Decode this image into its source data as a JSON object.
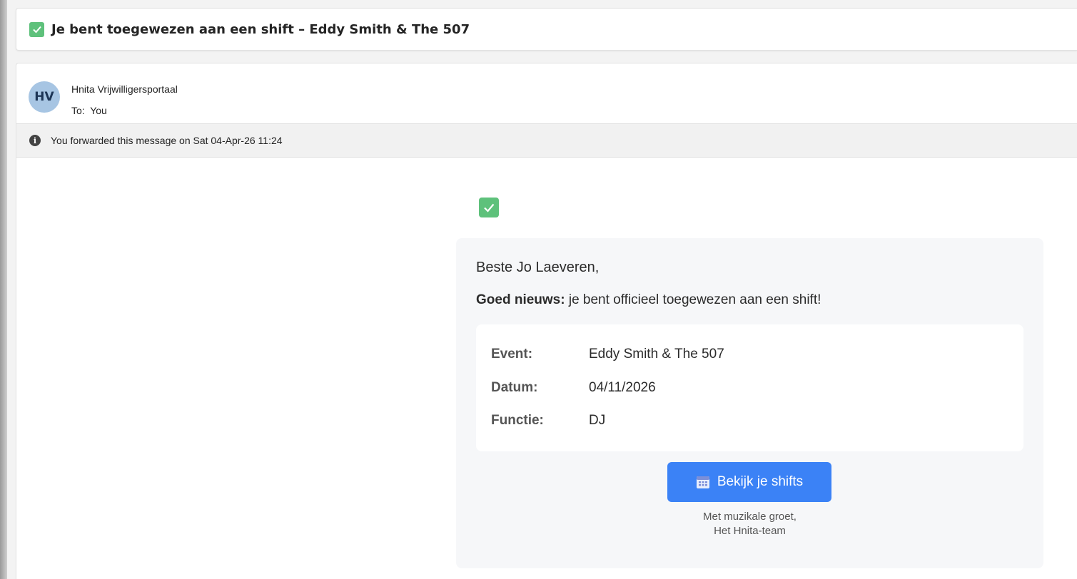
{
  "subject": "Je bent toegewezen aan een shift – Eddy Smith & The 507",
  "sender": {
    "initials": "HV",
    "name": "Hnita Vrijwilligersportaal",
    "to_label": "To:",
    "to_value": "You"
  },
  "forward_notice": "You forwarded this message on Sat 04-Apr-26 11:24",
  "email": {
    "greeting": "Beste Jo Laeveren,",
    "news_bold": "Goed nieuws:",
    "news_text": " je bent officieel toegewezen aan een shift!",
    "details": [
      {
        "label": "Event:",
        "value": "Eddy Smith & The 507"
      },
      {
        "label": "Datum:",
        "value": "04/11/2026"
      },
      {
        "label": "Functie:",
        "value": "DJ"
      }
    ],
    "button_label": "Bekijk je shifts",
    "signoff_line1": "Met muzikale groet,",
    "signoff_line2": "Het Hnita-team"
  },
  "colors": {
    "accent": "#3b82f6",
    "check_green": "#5ec17b",
    "avatar_bg": "#a7c5e3"
  },
  "icons": [
    "check-square-icon",
    "info-icon",
    "calendar-icon"
  ]
}
